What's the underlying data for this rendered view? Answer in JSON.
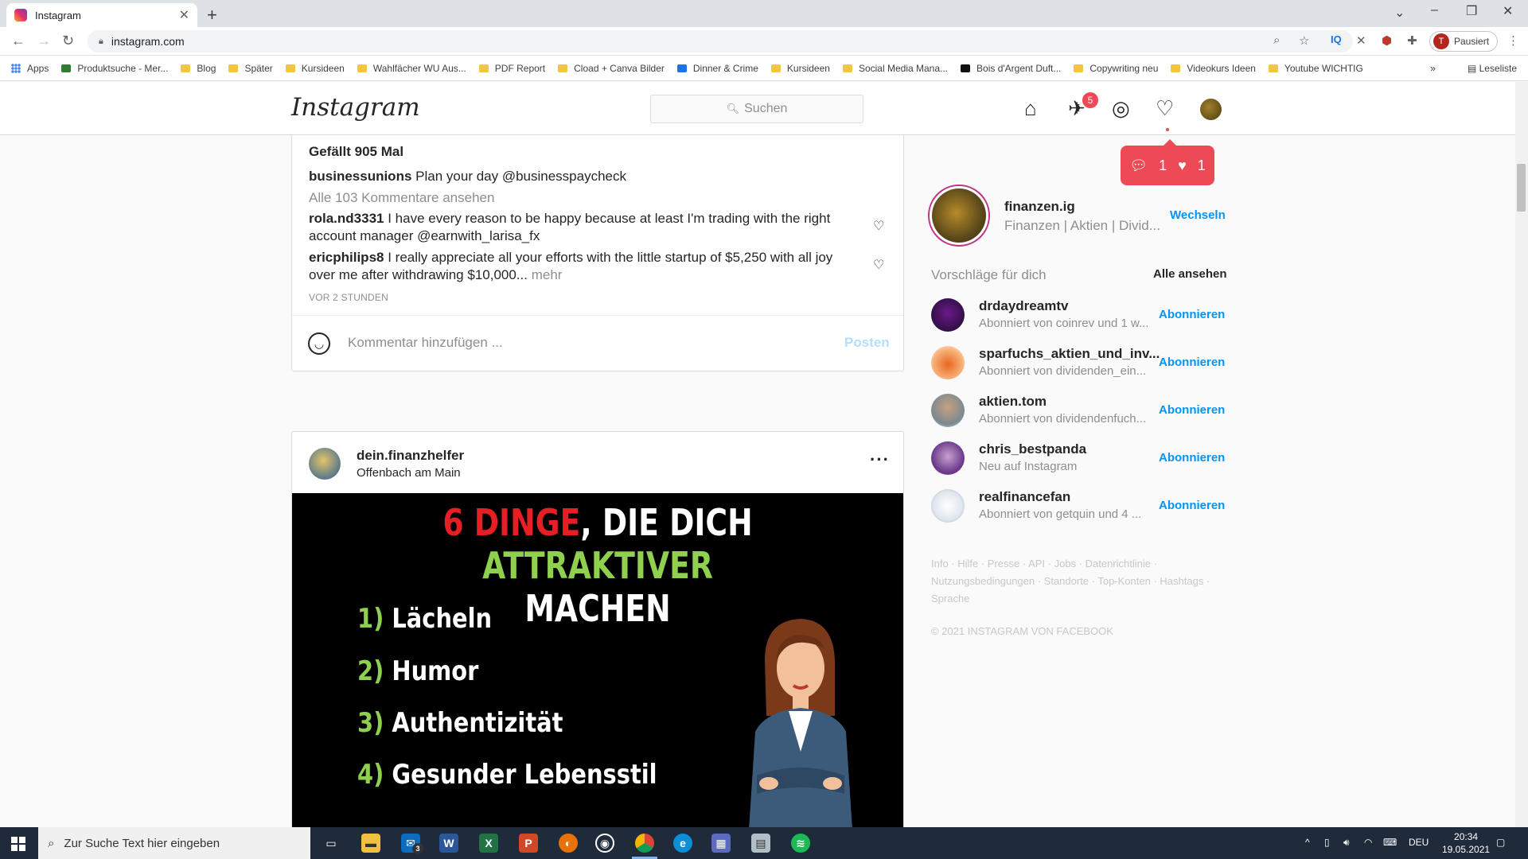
{
  "browser": {
    "tab_title": "Instagram",
    "url": "instagram.com",
    "profile_label": "Pausiert",
    "profile_initial": "T",
    "bookmarks": [
      "Apps",
      "Produktsuche - Mer...",
      "Blog",
      "Später",
      "Kursideen",
      "Wahlfächer WU Aus...",
      "PDF Report",
      "Cload + Canva Bilder",
      "Dinner & Crime",
      "Kursideen",
      "Social Media Mana...",
      "Bois d'Argent Duft...",
      "Copywriting neu",
      "Videokurs Ideen",
      "Youtube WICHTIG"
    ],
    "reading_list": "Leseliste"
  },
  "ig": {
    "logo": "Instagram",
    "search_placeholder": "Suchen",
    "dm_badge": "5",
    "notif_comments": "1",
    "notif_likes": "1"
  },
  "post1": {
    "likes": "Gefällt 905 Mal",
    "caption_user": "businessunions",
    "caption_text": "Plan your day @businesspaycheck",
    "view_all": "Alle 103 Kommentare ansehen",
    "comments": [
      {
        "user": "rola.nd3331",
        "text": "I have every reason to be happy because at least I'm trading with the right account manager @earnwith_larisa_fx",
        "more": ""
      },
      {
        "user": "ericphilips8",
        "text": "I really appreciate all your efforts with the little startup of $5,250 with all joy over me after withdrawing $10,000...",
        "more": "mehr"
      }
    ],
    "time": "VOR 2 STUNDEN",
    "comment_placeholder": "Kommentar hinzufügen ...",
    "post_button": "Posten"
  },
  "post2": {
    "user": "dein.finanzhelfer",
    "location": "Offenbach am Main",
    "image": {
      "title_red": "6 DINGE",
      "title_white": ", DIE DICH ",
      "title_green": "ATTRAKTIVER",
      "title_line2": "MACHEN",
      "items": [
        {
          "num": "1)",
          "text": "Lächeln"
        },
        {
          "num": "2)",
          "text": "Humor"
        },
        {
          "num": "3)",
          "text": "Authentizität"
        },
        {
          "num": "4)",
          "text": "Gesunder Lebensstil"
        }
      ]
    }
  },
  "sidebar": {
    "username": "finanzen.ig",
    "fullname": "Finanzen | Aktien | Divid...",
    "switch_label": "Wechseln",
    "suggestions_title": "Vorschläge für dich",
    "see_all": "Alle ansehen",
    "follow_label": "Abonnieren",
    "suggestions": [
      {
        "user": "drdaydreamtv",
        "sub": "Abonniert von coinrev und 1 w..."
      },
      {
        "user": "sparfuchs_aktien_und_inv...",
        "sub": "Abonniert von dividenden_ein..."
      },
      {
        "user": "aktien.tom",
        "sub": "Abonniert von dividendenfuch..."
      },
      {
        "user": "chris_bestpanda",
        "sub": "Neu auf Instagram"
      },
      {
        "user": "realfinancefan",
        "sub": "Abonniert von getquin und 4 ..."
      }
    ],
    "footer_links": "Info · Hilfe · Presse · API · Jobs · Datenrichtlinie · Nutzungsbedingungen · Standorte · Top-Konten · Hashtags · Sprache",
    "copyright": "© 2021 INSTAGRAM VON FACEBOOK"
  },
  "taskbar": {
    "search_placeholder": "Zur Suche Text hier eingeben",
    "mail_badge": "3",
    "language": "DEU",
    "time": "20:34",
    "date": "19.05.2021"
  }
}
